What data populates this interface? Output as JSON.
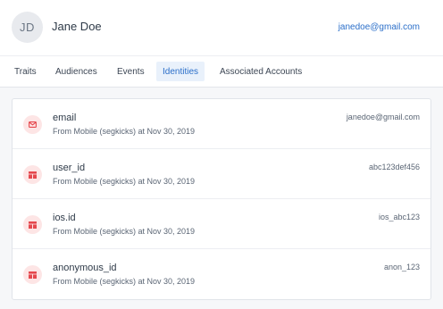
{
  "profile": {
    "initials": "JD",
    "name": "Jane Doe",
    "email": "janedoe@gmail.com"
  },
  "tabs": [
    {
      "label": "Traits",
      "active": false
    },
    {
      "label": "Audiences",
      "active": false
    },
    {
      "label": "Events",
      "active": false
    },
    {
      "label": "Identities",
      "active": true
    },
    {
      "label": "Associated Accounts",
      "active": false
    }
  ],
  "identities": [
    {
      "icon": "mail-icon",
      "key": "email",
      "source": "From Mobile (segkicks) at Nov 30, 2019",
      "value": "janedoe@gmail.com"
    },
    {
      "icon": "id-card-icon",
      "key": "user_id",
      "source": "From Mobile (segkicks) at Nov 30, 2019",
      "value": "abc123def456"
    },
    {
      "icon": "id-card-icon",
      "key": "ios.id",
      "source": "From Mobile (segkicks) at Nov 30, 2019",
      "value": "ios_abc123"
    },
    {
      "icon": "id-card-icon",
      "key": "anonymous_id",
      "source": "From Mobile (segkicks) at Nov 30, 2019",
      "value": "anon_123"
    }
  ],
  "colors": {
    "accent": "#2b6fc9",
    "icon_bg": "#fde5e5",
    "icon_fg": "#e5484d"
  }
}
